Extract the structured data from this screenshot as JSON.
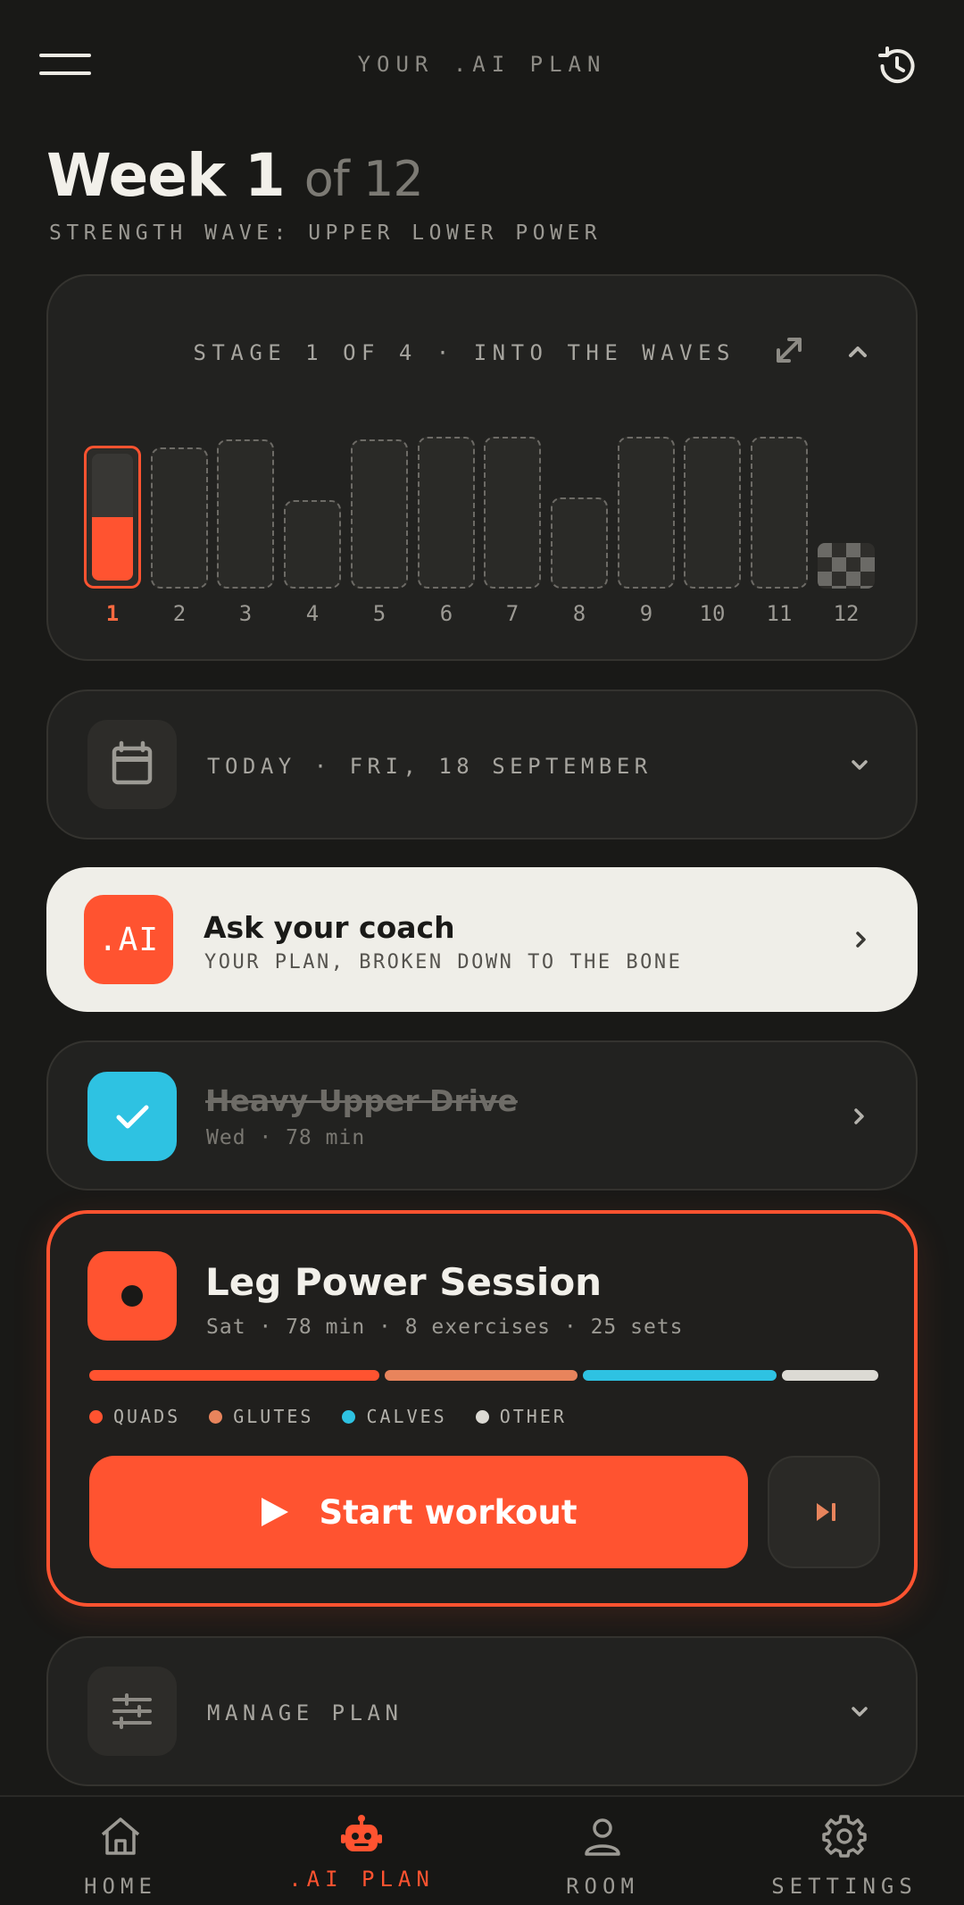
{
  "header": {
    "title": "YOUR .AI PLAN",
    "menu_icon": "hamburger-icon",
    "history_icon": "history-icon"
  },
  "week": {
    "label": "Week 1",
    "of": "of 12",
    "program": "STRENGTH WAVE: UPPER LOWER POWER"
  },
  "stage": {
    "label": "STAGE 1 OF 4 · INTO THE WAVES",
    "expand_icon": "expand-icon",
    "collapse_icon": "chevron-up-icon"
  },
  "chart_data": {
    "type": "bar",
    "categories": [
      "1",
      "2",
      "3",
      "4",
      "5",
      "6",
      "7",
      "8",
      "9",
      "10",
      "11",
      "12"
    ],
    "values": [
      0.94,
      0.93,
      0.98,
      0.58,
      0.98,
      1.0,
      1.0,
      0.6,
      1.0,
      1.0,
      1.0,
      0.3
    ],
    "current_week": 1,
    "current_progress": 0.5,
    "ylim": [
      0,
      1
    ],
    "grid": false,
    "final_week_marker": "checkered-flag",
    "colors": {
      "current": "#ff5330",
      "outline": "#6d6b66"
    }
  },
  "today": {
    "label": "TODAY · FRI, 18 SEPTEMBER",
    "icon": "calendar-icon"
  },
  "coach": {
    "badge": ".AI",
    "title": "Ask your coach",
    "subtitle": "YOUR PLAN, BROKEN DOWN TO THE BONE"
  },
  "completed_workout": {
    "title": "Heavy Upper Drive",
    "meta": "Wed · 78 min",
    "icon": "check-icon",
    "color": "#2ec2e2"
  },
  "next_session": {
    "title": "Leg Power Session",
    "meta": "Sat · 78 min · 8 exercises · 25 sets",
    "muscle_groups": [
      {
        "label": "QUADS",
        "color": "#ff5330",
        "share": 0.27
      },
      {
        "label": "GLUTES",
        "color": "#e8845c",
        "share": 0.18
      },
      {
        "label": "CALVES",
        "color": "#2ec2e2",
        "share": 0.18
      },
      {
        "label": "OTHER",
        "color": "#dcdad4",
        "share": 0.09
      }
    ],
    "start_label": "Start workout",
    "skip_icon": "skip-next-icon"
  },
  "manage": {
    "label": "MANAGE PLAN",
    "icon": "sliders-icon"
  },
  "nav": {
    "items": [
      {
        "label": "HOME",
        "icon": "home-icon"
      },
      {
        "label": ".AI PLAN",
        "icon": "robot-icon"
      },
      {
        "label": "ROOM",
        "icon": "person-icon"
      },
      {
        "label": "SETTINGS",
        "icon": "gear-icon"
      }
    ],
    "active": ".AI PLAN"
  },
  "colors": {
    "accent": "#ff5330",
    "background": "#191917",
    "card": "#222220",
    "coach_card": "#efeee8",
    "completed": "#2ec2e2"
  }
}
